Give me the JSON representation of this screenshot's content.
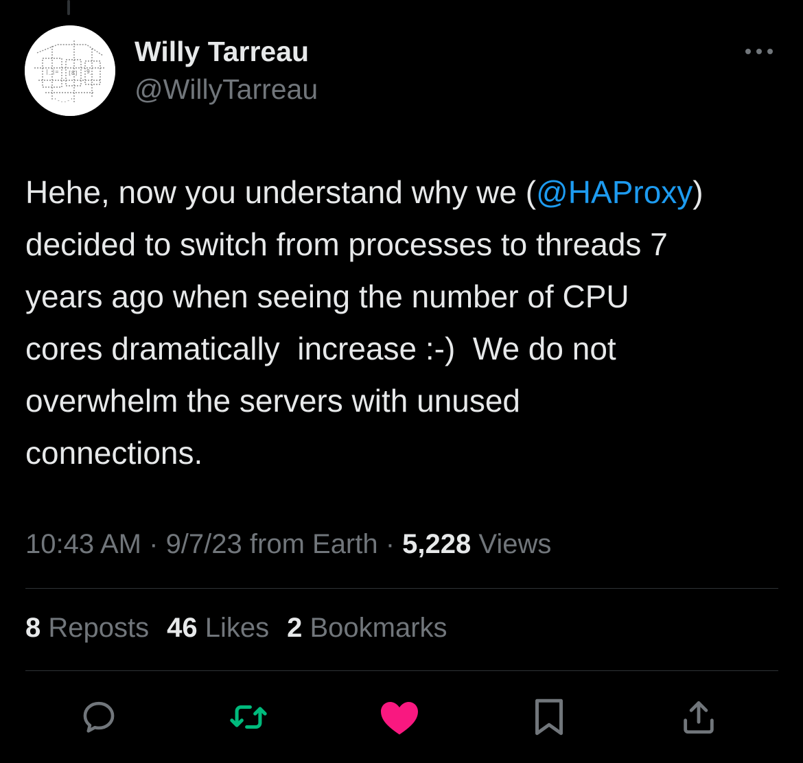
{
  "author": {
    "name": "Willy Tarreau",
    "handle": "@WillyTarreau"
  },
  "tweet": {
    "lines": [
      {
        "before": "Hehe, now you understand why we (",
        "mention": "@HAProxy",
        "after": ")"
      },
      {
        "text": "decided to switch from processes to threads 7"
      },
      {
        "text": "years ago when seeing the number of CPU"
      },
      {
        "text": "cores dramatically  increase :-)  We do not"
      },
      {
        "text": "overwhelm the servers with unused"
      },
      {
        "text": "connections."
      }
    ]
  },
  "meta": {
    "time": "10:43 AM",
    "sep1": " · ",
    "date": "9/7/23",
    "location": " from Earth",
    "sep2": " · ",
    "views_count": "5,228",
    "views_label": " Views"
  },
  "stats": {
    "reposts_count": "8",
    "reposts_label": " Reposts",
    "likes_count": "46",
    "likes_label": " Likes",
    "bookmarks_count": "2",
    "bookmarks_label": " Bookmarks"
  },
  "actions": {
    "reply_icon": "reply-icon",
    "repost_icon": "repost-icon",
    "like_icon": "heart-filled-icon",
    "bookmark_icon": "bookmark-icon",
    "share_icon": "share-icon"
  },
  "colors": {
    "background": "#000000",
    "text_primary": "#e7e9ea",
    "text_secondary": "#71767b",
    "mention": "#1d9bf0",
    "like_active": "#f91880",
    "repost": "#00ba7c",
    "divider": "#2f3336"
  }
}
